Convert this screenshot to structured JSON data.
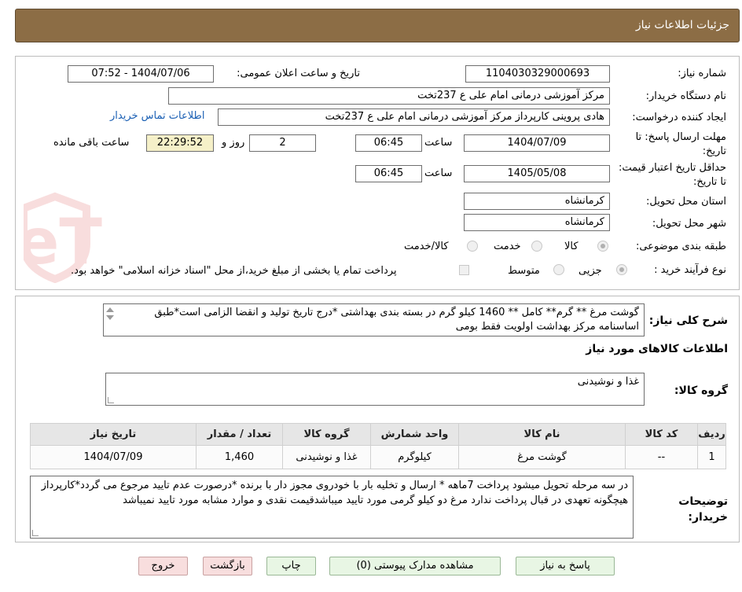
{
  "header": {
    "title": "جزئیات اطلاعات نیاز"
  },
  "form": {
    "need_number_label": "شماره نیاز:",
    "need_number": "1104030329000693",
    "announce_label": "تاریخ و ساعت اعلان عمومی:",
    "announce_value": "1404/07/06 - 07:52",
    "buyer_org_label": "نام دستگاه خریدار:",
    "buyer_org": "مرکز آموزشی درمانی امام علی ع 237تخت",
    "requester_label": "ایجاد کننده درخواست:",
    "requester": "هادی پروینی کارپرداز  مرکز آموزشی درمانی امام علی ع 237تخت",
    "contact_link": "اطلاعات تماس خریدار",
    "deadline_label": "مهلت ارسال پاسخ: تا تاریخ:",
    "deadline_date": "1404/07/09",
    "time_label": "ساعت",
    "deadline_time": "06:45",
    "days_value": "2",
    "days_label": "روز و",
    "remaining_time": "22:29:52",
    "remaining_label": "ساعت باقی مانده",
    "validity_label": "حداقل تاریخ اعتبار قیمت: تا تاریخ:",
    "validity_date": "1405/05/08",
    "validity_time": "06:45",
    "province_label": "استان محل تحویل:",
    "province": "کرمانشاه",
    "city_label": "شهر محل تحویل:",
    "city": "کرمانشاه",
    "category_label": "طبقه بندی موضوعی:",
    "category_options": [
      "کالا",
      "خدمت",
      "کالا/خدمت"
    ],
    "process_label": "نوع فرآیند خرید :",
    "process_options": [
      "جزیی",
      "متوسط"
    ],
    "payment_note": "پرداخت تمام یا بخشی از مبلغ خرید،از محل \"اسناد خزانه اسلامی\" خواهد بود."
  },
  "description": {
    "label": "شرح کلی نیاز:",
    "text": "گوشت مرغ ** گرم** کامل ** 1460 کیلو گرم در بسته بندی بهداشتی *درج تاریخ تولید و  انقضا الزامی است*طبق اساسنامه مرکز بهداشت اولویت فقط  بومی"
  },
  "goods": {
    "section_title": "اطلاعات کالاهای مورد نیاز",
    "group_label": "گروه کالا:",
    "group_value": "غذا و نوشیدنی",
    "columns": [
      "ردیف",
      "کد کالا",
      "نام کالا",
      "واحد شمارش",
      "گروه کالا",
      "تعداد / مقدار",
      "تاریخ نیاز"
    ],
    "rows": [
      [
        "1",
        "--",
        "گوشت مرغ",
        "کیلوگرم",
        "غذا و نوشیدنی",
        "1,460",
        "1404/07/09"
      ]
    ]
  },
  "buyer_notes": {
    "label": "توضیحات خریدار:",
    "text": "در  سه  مرحله تحویل میشود  پرداخت 7ماهه * ارسال و تخلیه بار  با خودروی مجوز دار با برنده *درصورت عدم تایید مرجوع می گردد*کارپرداز هیچگونه تعهدی در قبال پرداخت ندارد  مرغ دو کیلو گرمی مورد تایید میباشدقیمت نقدی و موارد مشابه مورد تایید نمیباشد"
  },
  "buttons": {
    "reply": "پاسخ به نیاز",
    "attachments": "مشاهده مدارک پیوستی (0)",
    "print": "چاپ",
    "back": "بازگشت",
    "exit": "خروج"
  },
  "watermark": {
    "text": "AriaTender.neT"
  },
  "colors": {
    "header_bg": "#8c6d45",
    "link": "#1a5fb4",
    "remaining_bg": "#f5f0c8",
    "reply_btn_bg": "#e8f6e4",
    "back_exit_bg": "#f8dede"
  }
}
